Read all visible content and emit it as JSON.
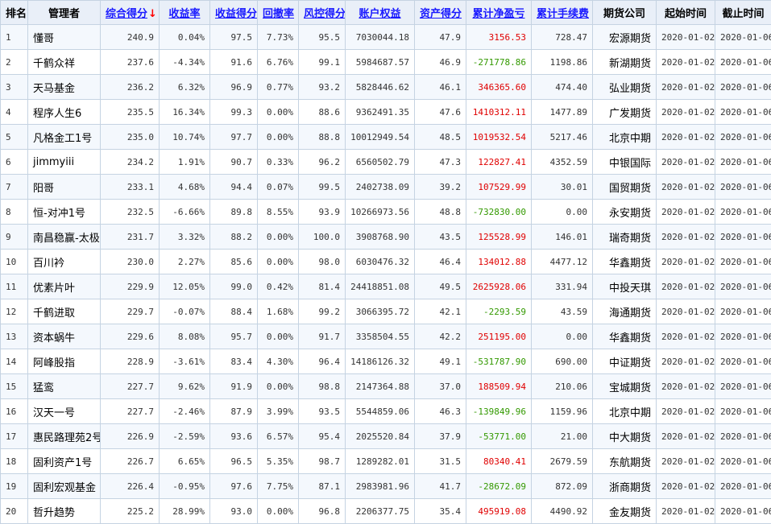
{
  "colors": {
    "header_bg": "#e9eff8",
    "border": "#c5d3e2",
    "link": "#1a1aff",
    "sort_arrow": "#ff0000",
    "positive": "#e00000",
    "negative": "#339900"
  },
  "headers": {
    "rank": "排名",
    "manager": "管理者",
    "composite": "综合得分",
    "composite_arrow": "↓",
    "return_rate": "收益率",
    "return_score": "收益得分",
    "drawdown": "回撤率",
    "risk_score": "风控得分",
    "equity": "账户权益",
    "asset_score": "资产得分",
    "net_profit": "累计净盈亏",
    "fees": "累计手续费",
    "company": "期货公司",
    "start": "起始时间",
    "end": "截止时间"
  },
  "rows": [
    {
      "rank": "1",
      "manager": "懂哥",
      "composite": "240.9",
      "return_rate": "0.04%",
      "return_score": "97.5",
      "drawdown": "7.73%",
      "risk_score": "95.5",
      "equity": "7030044.18",
      "asset_score": "47.9",
      "net_profit": "3156.53",
      "fees": "728.47",
      "company": "宏源期货",
      "start": "2020-01-02",
      "end": "2020-01-06"
    },
    {
      "rank": "2",
      "manager": "千鹤众祥",
      "composite": "237.6",
      "return_rate": "-4.34%",
      "return_score": "91.6",
      "drawdown": "6.76%",
      "risk_score": "99.1",
      "equity": "5984687.57",
      "asset_score": "46.9",
      "net_profit": "-271778.86",
      "fees": "1198.86",
      "company": "新湖期货",
      "start": "2020-01-02",
      "end": "2020-01-06"
    },
    {
      "rank": "3",
      "manager": "天马基金",
      "composite": "236.2",
      "return_rate": "6.32%",
      "return_score": "96.9",
      "drawdown": "0.77%",
      "risk_score": "93.2",
      "equity": "5828446.62",
      "asset_score": "46.1",
      "net_profit": "346365.60",
      "fees": "474.40",
      "company": "弘业期货",
      "start": "2020-01-02",
      "end": "2020-01-06"
    },
    {
      "rank": "4",
      "manager": "程序人生6",
      "composite": "235.5",
      "return_rate": "16.34%",
      "return_score": "99.3",
      "drawdown": "0.00%",
      "risk_score": "88.6",
      "equity": "9362491.35",
      "asset_score": "47.6",
      "net_profit": "1410312.11",
      "fees": "1477.89",
      "company": "广发期货",
      "start": "2020-01-02",
      "end": "2020-01-06"
    },
    {
      "rank": "5",
      "manager": "凡格金工1号",
      "composite": "235.0",
      "return_rate": "10.74%",
      "return_score": "97.7",
      "drawdown": "0.00%",
      "risk_score": "88.8",
      "equity": "10012949.54",
      "asset_score": "48.5",
      "net_profit": "1019532.54",
      "fees": "5217.46",
      "company": "北京中期",
      "start": "2020-01-02",
      "end": "2020-01-06"
    },
    {
      "rank": "6",
      "manager": "jimmyiii",
      "composite": "234.2",
      "return_rate": "1.91%",
      "return_score": "90.7",
      "drawdown": "0.33%",
      "risk_score": "96.2",
      "equity": "6560502.79",
      "asset_score": "47.3",
      "net_profit": "122827.41",
      "fees": "4352.59",
      "company": "中银国际",
      "start": "2020-01-02",
      "end": "2020-01-06"
    },
    {
      "rank": "7",
      "manager": "阳哥",
      "composite": "233.1",
      "return_rate": "4.68%",
      "return_score": "94.4",
      "drawdown": "0.07%",
      "risk_score": "99.5",
      "equity": "2402738.09",
      "asset_score": "39.2",
      "net_profit": "107529.99",
      "fees": "30.01",
      "company": "国贸期货",
      "start": "2020-01-02",
      "end": "2020-01-06"
    },
    {
      "rank": "8",
      "manager": "恒-对冲1号",
      "composite": "232.5",
      "return_rate": "-6.66%",
      "return_score": "89.8",
      "drawdown": "8.55%",
      "risk_score": "93.9",
      "equity": "10266973.56",
      "asset_score": "48.8",
      "net_profit": "-732830.00",
      "fees": "0.00",
      "company": "永安期货",
      "start": "2020-01-02",
      "end": "2020-01-06"
    },
    {
      "rank": "9",
      "manager": "南昌稳赢-太极",
      "composite": "231.7",
      "return_rate": "3.32%",
      "return_score": "88.2",
      "drawdown": "0.00%",
      "risk_score": "100.0",
      "equity": "3908768.90",
      "asset_score": "43.5",
      "net_profit": "125528.99",
      "fees": "146.01",
      "company": "瑞奇期货",
      "start": "2020-01-02",
      "end": "2020-01-06"
    },
    {
      "rank": "10",
      "manager": "百川衿",
      "composite": "230.0",
      "return_rate": "2.27%",
      "return_score": "85.6",
      "drawdown": "0.00%",
      "risk_score": "98.0",
      "equity": "6030476.32",
      "asset_score": "46.4",
      "net_profit": "134012.88",
      "fees": "4477.12",
      "company": "华鑫期货",
      "start": "2020-01-02",
      "end": "2020-01-06"
    },
    {
      "rank": "11",
      "manager": "优素片叶",
      "composite": "229.9",
      "return_rate": "12.05%",
      "return_score": "99.0",
      "drawdown": "0.42%",
      "risk_score": "81.4",
      "equity": "24418851.08",
      "asset_score": "49.5",
      "net_profit": "2625928.06",
      "fees": "331.94",
      "company": "中投天琪",
      "start": "2020-01-02",
      "end": "2020-01-06"
    },
    {
      "rank": "12",
      "manager": "千鹤进取",
      "composite": "229.7",
      "return_rate": "-0.07%",
      "return_score": "88.4",
      "drawdown": "1.68%",
      "risk_score": "99.2",
      "equity": "3066395.72",
      "asset_score": "42.1",
      "net_profit": "-2293.59",
      "fees": "43.59",
      "company": "海通期货",
      "start": "2020-01-02",
      "end": "2020-01-06"
    },
    {
      "rank": "13",
      "manager": "资本蜗牛",
      "composite": "229.6",
      "return_rate": "8.08%",
      "return_score": "95.7",
      "drawdown": "0.00%",
      "risk_score": "91.7",
      "equity": "3358504.55",
      "asset_score": "42.2",
      "net_profit": "251195.00",
      "fees": "0.00",
      "company": "华鑫期货",
      "start": "2020-01-02",
      "end": "2020-01-06"
    },
    {
      "rank": "14",
      "manager": "阿峰股指",
      "composite": "228.9",
      "return_rate": "-3.61%",
      "return_score": "83.4",
      "drawdown": "4.30%",
      "risk_score": "96.4",
      "equity": "14186126.32",
      "asset_score": "49.1",
      "net_profit": "-531787.90",
      "fees": "690.00",
      "company": "中证期货",
      "start": "2020-01-02",
      "end": "2020-01-06"
    },
    {
      "rank": "15",
      "manager": "猛鸾",
      "composite": "227.7",
      "return_rate": "9.62%",
      "return_score": "91.9",
      "drawdown": "0.00%",
      "risk_score": "98.8",
      "equity": "2147364.88",
      "asset_score": "37.0",
      "net_profit": "188509.94",
      "fees": "210.06",
      "company": "宝城期货",
      "start": "2020-01-02",
      "end": "2020-01-06"
    },
    {
      "rank": "16",
      "manager": "汉天一号",
      "composite": "227.7",
      "return_rate": "-2.46%",
      "return_score": "87.9",
      "drawdown": "3.99%",
      "risk_score": "93.5",
      "equity": "5544859.06",
      "asset_score": "46.3",
      "net_profit": "-139849.96",
      "fees": "1159.96",
      "company": "北京中期",
      "start": "2020-01-02",
      "end": "2020-01-06"
    },
    {
      "rank": "17",
      "manager": "惠民路理苑2号",
      "composite": "226.9",
      "return_rate": "-2.59%",
      "return_score": "93.6",
      "drawdown": "6.57%",
      "risk_score": "95.4",
      "equity": "2025520.84",
      "asset_score": "37.9",
      "net_profit": "-53771.00",
      "fees": "21.00",
      "company": "中大期货",
      "start": "2020-01-02",
      "end": "2020-01-06"
    },
    {
      "rank": "18",
      "manager": "固利资产1号",
      "composite": "226.7",
      "return_rate": "6.65%",
      "return_score": "96.5",
      "drawdown": "5.35%",
      "risk_score": "98.7",
      "equity": "1289282.01",
      "asset_score": "31.5",
      "net_profit": "80340.41",
      "fees": "2679.59",
      "company": "东航期货",
      "start": "2020-01-02",
      "end": "2020-01-06"
    },
    {
      "rank": "19",
      "manager": "固利宏观基金",
      "composite": "226.4",
      "return_rate": "-0.95%",
      "return_score": "97.6",
      "drawdown": "7.75%",
      "risk_score": "87.1",
      "equity": "2983981.96",
      "asset_score": "41.7",
      "net_profit": "-28672.09",
      "fees": "872.09",
      "company": "浙商期货",
      "start": "2020-01-02",
      "end": "2020-01-06"
    },
    {
      "rank": "20",
      "manager": "哲升趋势",
      "composite": "225.2",
      "return_rate": "28.99%",
      "return_score": "93.0",
      "drawdown": "0.00%",
      "risk_score": "96.8",
      "equity": "2206377.75",
      "asset_score": "35.4",
      "net_profit": "495919.08",
      "fees": "4490.92",
      "company": "金友期货",
      "start": "2020-01-02",
      "end": "2020-01-06"
    }
  ]
}
